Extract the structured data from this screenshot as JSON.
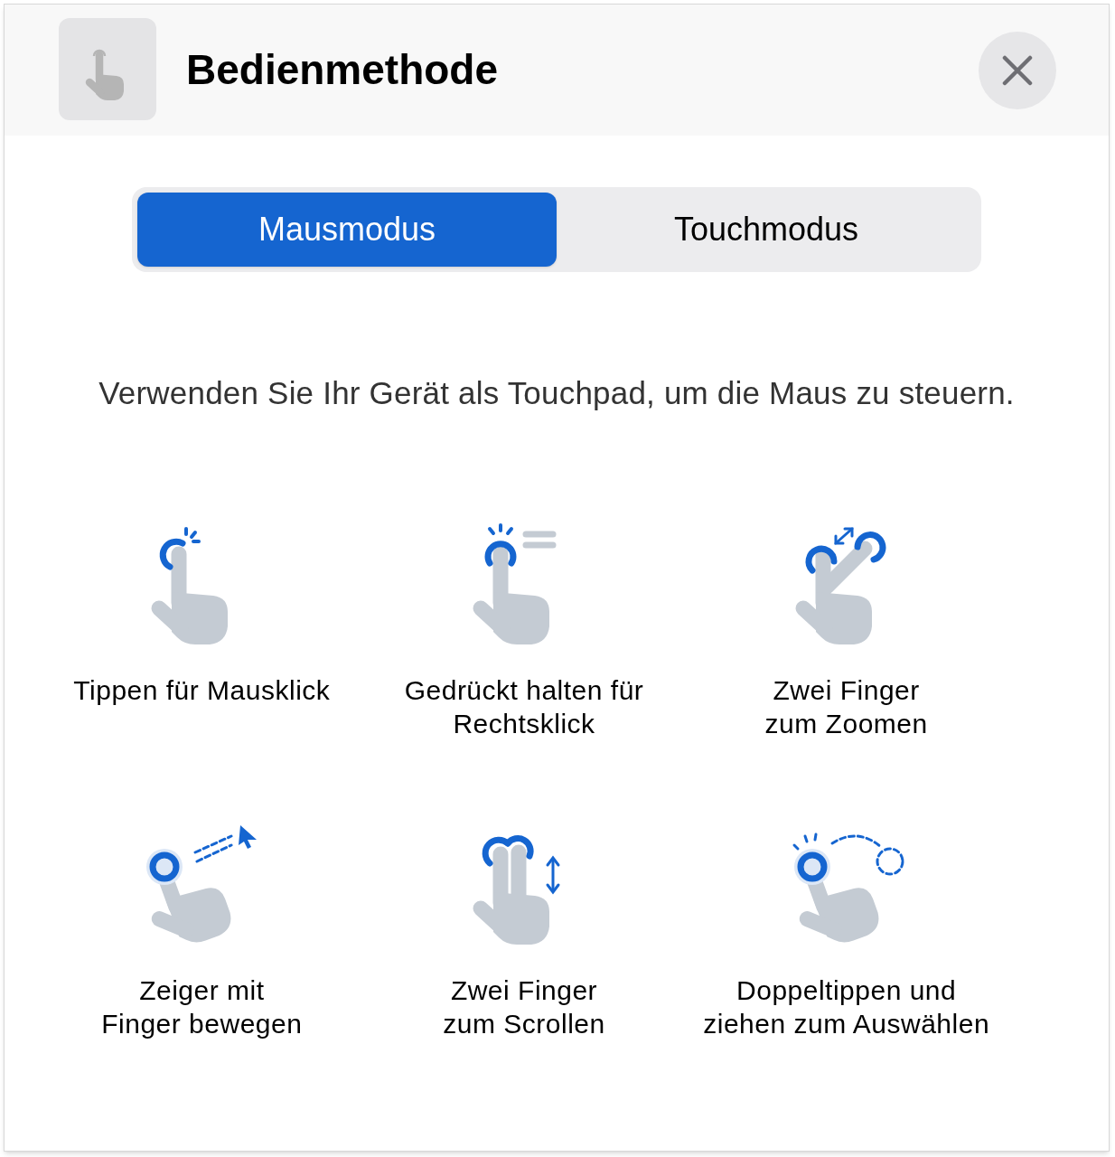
{
  "header": {
    "title": "Bedienmethode"
  },
  "tabs": [
    {
      "label": "Mausmodus",
      "selected": true
    },
    {
      "label": "Touchmodus",
      "selected": false
    }
  ],
  "description": "Verwenden Sie Ihr Gerät als Touchpad, um die Maus zu steuern.",
  "gestures": [
    {
      "kind": "tap",
      "label": "Tippen für Mausklick"
    },
    {
      "kind": "long-press",
      "label": "Gedrückt halten für\nRechtsklick"
    },
    {
      "kind": "zoom",
      "label": "Zwei Finger\nzum Zoomen"
    },
    {
      "kind": "pointer",
      "label": "Zeiger mit\nFinger bewegen"
    },
    {
      "kind": "scroll",
      "label": "Zwei Finger\nzum Scrollen"
    },
    {
      "kind": "double-tap-drag",
      "label": "Doppeltippen und\nziehen zum Auswählen"
    }
  ]
}
